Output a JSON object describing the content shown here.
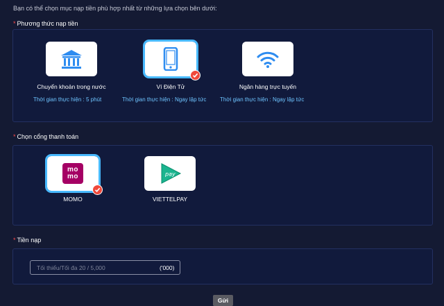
{
  "intro": "Bạn có thể chọn mục nạp tiền phù hợp nhất từ những lựa chọn bên dưới:",
  "method_section": {
    "label": "Phương thức nạp tiền",
    "options": [
      {
        "label": "Chuyển khoản trong nước",
        "time_label": "Thời gian thực hiện",
        "time_value": "5 phút",
        "icon": "bank-icon",
        "selected": false
      },
      {
        "label": "Ví Điện Tử",
        "time_label": "Thời gian thực hiện",
        "time_value": "Ngay lập tức",
        "icon": "mobile-phone-icon",
        "selected": true
      },
      {
        "label": "Ngân hàng trực tuyến",
        "time_label": "Thời gian thực hiện",
        "time_value": "Ngay lập tức",
        "icon": "wifi-icon",
        "selected": false
      }
    ]
  },
  "gateway_section": {
    "label": "Chọn cổng thanh toán",
    "options": [
      {
        "label": "MOMO",
        "logo_text": "mo mo",
        "icon": "momo-logo",
        "selected": true
      },
      {
        "label": "VIETTELPAY",
        "logo_text": "pay",
        "icon": "viettelpay-logo",
        "selected": false
      }
    ]
  },
  "amount_section": {
    "label": "Tiền nạp",
    "placeholder": "Tối thiểu/Tối đa 20 / 5,000",
    "value": "",
    "unit": "('000)"
  },
  "submit_label": "Gửi",
  "colors": {
    "background": "#141a33",
    "panel": "#111a3c",
    "accent_blue": "#48b9ff",
    "check_red": "#f0493b",
    "time_text": "#6ec4ff"
  }
}
